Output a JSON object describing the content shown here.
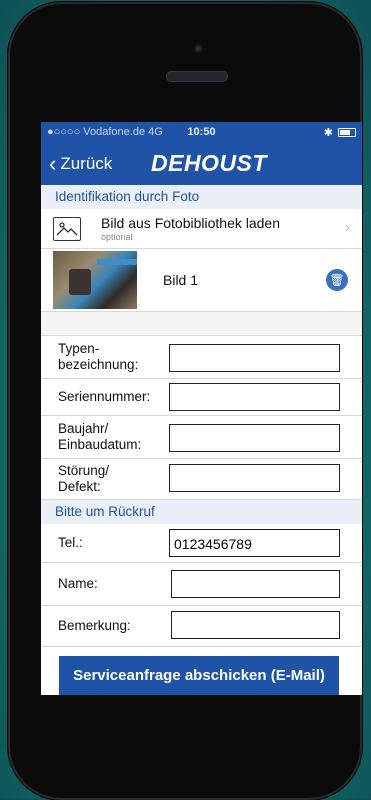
{
  "status": {
    "carrier": "●○○○○ Vodafone.de  4G",
    "time": "10:50",
    "bluetooth": "✱"
  },
  "nav": {
    "back_label": "Zurück",
    "logo": "DEHOUST"
  },
  "section_photo": {
    "title": "Identifikation durch Foto"
  },
  "library": {
    "label": "Bild aus Fotobibliothek laden",
    "sub": "optional"
  },
  "photo": {
    "label": "Bild 1"
  },
  "fields": {
    "typ": {
      "label_line1": "Typen-",
      "label_line2": "bezeichnung:",
      "value": ""
    },
    "serial": {
      "label": "Seriennummer:",
      "value": ""
    },
    "baujahr": {
      "label_line1": "Baujahr/",
      "label_line2": "Einbaudatum:",
      "value": ""
    },
    "stoerung": {
      "label_line1": "Störung/",
      "label_line2": "Defekt:",
      "value": ""
    }
  },
  "section_callback": {
    "title": "Bitte um Rückruf"
  },
  "callback": {
    "tel": {
      "label": "Tel.:",
      "value": "0123456789"
    },
    "name": {
      "label": "Name:",
      "value": ""
    },
    "bemerkung": {
      "label": "Bemerkung:",
      "value": ""
    }
  },
  "submit": {
    "label": "Serviceanfrage abschicken (E-Mail)"
  },
  "colors": {
    "brand_blue": "#1f53a8",
    "section_bg": "#e9eef7"
  }
}
